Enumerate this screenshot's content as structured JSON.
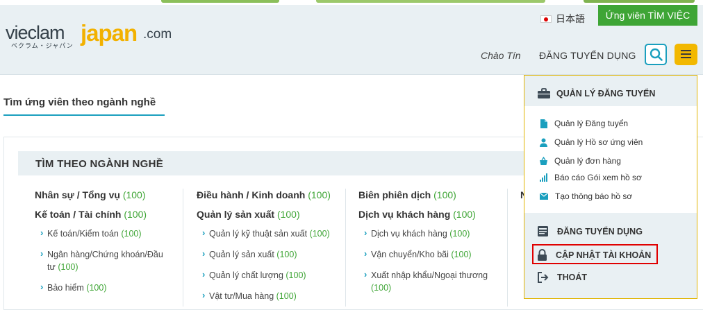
{
  "header": {
    "logo": {
      "part1": "vieclam",
      "part2": "japan",
      "part3": ".com",
      "kana": "ベクラム・ジャパン"
    },
    "language_label": "日本語",
    "job_seeker_button": "Ứng viên TÌM VIỆC",
    "greeting": "Chào Tín",
    "post_job_nav": "ĐĂNG TUYỂN DỤNG",
    "search_icon": "search-icon",
    "menu_icon": "hamburger-icon"
  },
  "section": {
    "title": "Tìm ứng viên theo ngành nghề",
    "panel_heading": "TÌM THEO NGÀNH NGHỀ"
  },
  "columns": [
    {
      "items": [
        {
          "type": "cat",
          "label": "Nhân sự / Tổng vụ",
          "count": "(100)"
        },
        {
          "type": "cat",
          "label": "Kế toán / Tài chính",
          "count": "(100)"
        },
        {
          "type": "sub",
          "label": "Kế toán/Kiểm toán",
          "count": "(100)"
        },
        {
          "type": "sub",
          "label": "Ngân hàng/Chứng khoán/Đầu tư",
          "count": "(100)"
        },
        {
          "type": "sub",
          "label": "Bảo hiểm",
          "count": "(100)"
        }
      ]
    },
    {
      "items": [
        {
          "type": "cat",
          "label": "Điều hành / Kinh doanh",
          "count": "(100)"
        },
        {
          "type": "cat",
          "label": "Quản lý sản xuất",
          "count": "(100)"
        },
        {
          "type": "sub",
          "label": "Quản lý kỹ thuật sản xuất",
          "count": "(100)"
        },
        {
          "type": "sub",
          "label": "Quản lý sản xuất",
          "count": "(100)"
        },
        {
          "type": "sub",
          "label": "Quản lý chất lượng",
          "count": "(100)"
        },
        {
          "type": "sub",
          "label": "Vật tư/Mua hàng",
          "count": "(100)"
        }
      ]
    },
    {
      "items": [
        {
          "type": "cat",
          "label": "Biên phiên dịch",
          "count": "(100)"
        },
        {
          "type": "cat",
          "label": "Dịch vụ khách hàng",
          "count": "(100)"
        },
        {
          "type": "sub",
          "label": "Dịch vụ khách hàng",
          "count": "(100)"
        },
        {
          "type": "sub",
          "label": "Vận chuyển/Kho bãi",
          "count": "(100)"
        },
        {
          "type": "sub",
          "label": "Xuất nhập khẩu/Ngoại thương",
          "count": "(100)"
        }
      ]
    },
    {
      "items": [
        {
          "type": "cat",
          "label": "N",
          "count": ""
        }
      ]
    }
  ],
  "dropdown": {
    "heading": "QUẢN LÝ ĐĂNG TUYỂN",
    "items": [
      {
        "label": "Quản lý Đăng tuyển",
        "icon": "document-icon"
      },
      {
        "label": "Quản lý Hồ sơ ứng viên",
        "icon": "user-icon"
      },
      {
        "label": "Quản lý đơn hàng",
        "icon": "basket-icon"
      },
      {
        "label": "Báo cáo Gói xem hồ sơ",
        "icon": "bar-chart-icon"
      },
      {
        "label": "Tạo thông báo hồ sơ",
        "icon": "envelope-icon"
      }
    ],
    "post_job": "ĐĂNG TUYỂN DỤNG",
    "update_account": "CẬP NHẬT TÀI KHOẢN",
    "logout": "THOÁT"
  },
  "colors": {
    "accent_blue": "#1a9fbe",
    "accent_green": "#3ea535",
    "accent_yellow": "#f2b800",
    "highlight_red": "#e00000"
  }
}
